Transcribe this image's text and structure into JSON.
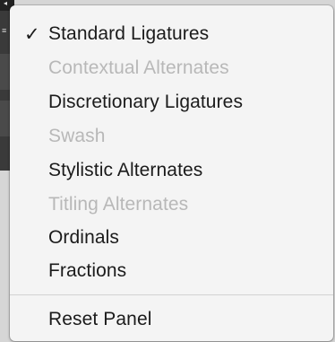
{
  "menu": {
    "items": [
      {
        "label": "Standard Ligatures",
        "checked": true,
        "enabled": true
      },
      {
        "label": "Contextual Alternates",
        "checked": false,
        "enabled": false
      },
      {
        "label": "Discretionary Ligatures",
        "checked": false,
        "enabled": true
      },
      {
        "label": "Swash",
        "checked": false,
        "enabled": false
      },
      {
        "label": "Stylistic Alternates",
        "checked": false,
        "enabled": true
      },
      {
        "label": "Titling Alternates",
        "checked": false,
        "enabled": false
      },
      {
        "label": "Ordinals",
        "checked": false,
        "enabled": true
      },
      {
        "label": "Fractions",
        "checked": false,
        "enabled": true
      }
    ],
    "reset_label": "Reset Panel",
    "check_glyph": "✓"
  },
  "colors": {
    "enabled_text": "#1b1b1b",
    "disabled_text": "#b8b8b8",
    "menu_background": "#f4f4f4"
  },
  "icons": {
    "checkmark": "checkmark-icon",
    "panel_menu": "hamburger-icon",
    "panel_arrow": "arrow-icon"
  }
}
